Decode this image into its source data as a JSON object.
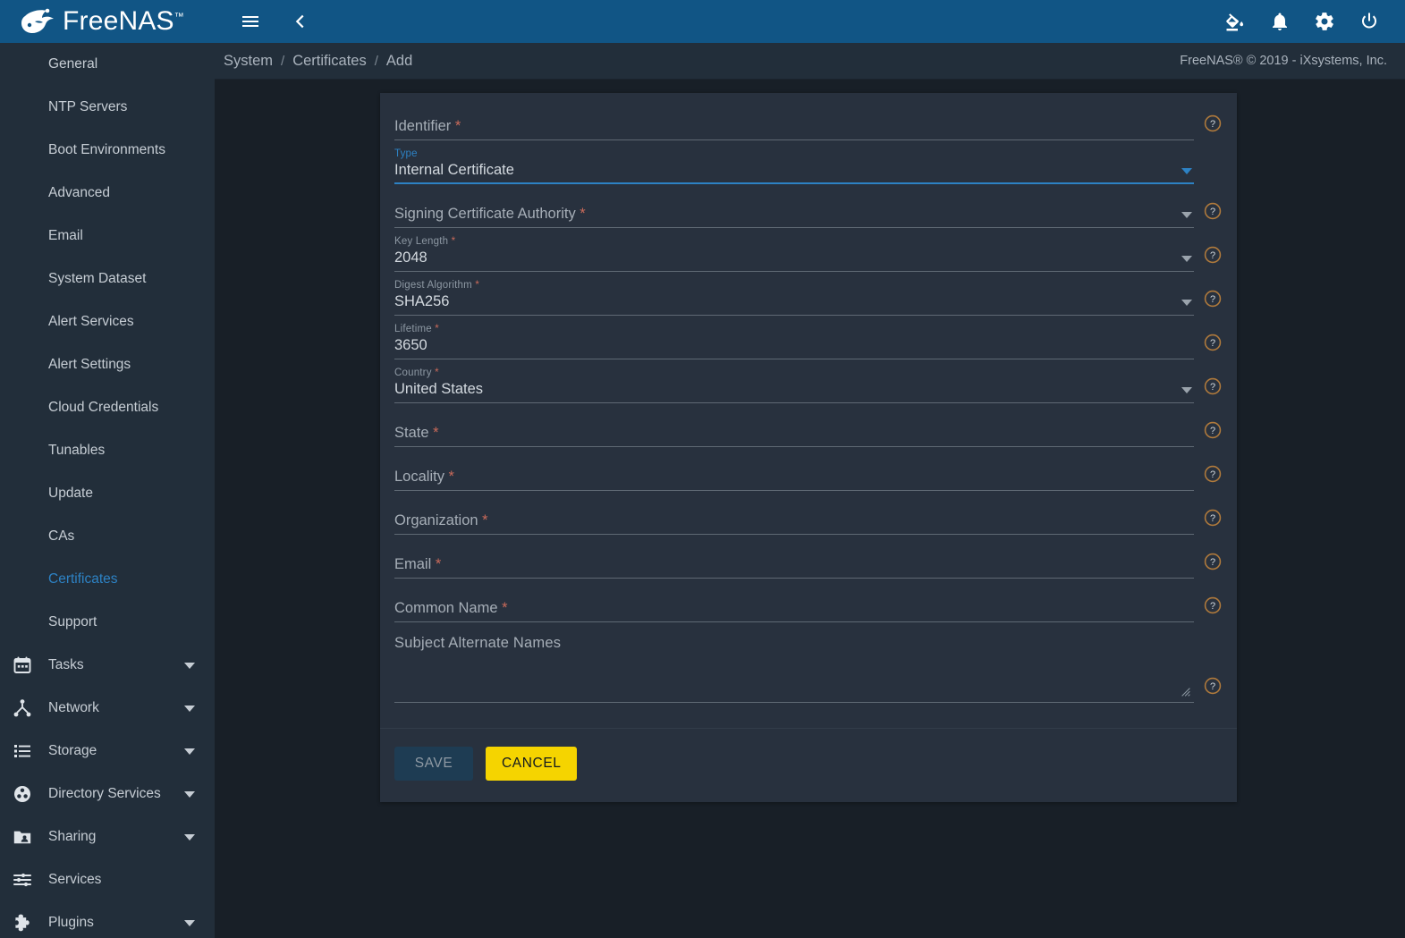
{
  "brand": {
    "name": "FreeNAS",
    "tm": "™",
    "logo_icon": "freenas-shark-logo"
  },
  "topbar": {
    "menu_icon": "hamburger-menu-icon",
    "back_icon": "chevron-left-icon",
    "actions": [
      {
        "name": "theme-picker-icon",
        "label": "Theme"
      },
      {
        "name": "notifications-bell-icon",
        "label": "Notifications"
      },
      {
        "name": "settings-gear-icon",
        "label": "Settings"
      },
      {
        "name": "power-icon",
        "label": "Power"
      }
    ],
    "accent_color": "#115585"
  },
  "sidebar": {
    "sub_items": [
      {
        "label": "General",
        "active": false
      },
      {
        "label": "NTP Servers",
        "active": false
      },
      {
        "label": "Boot Environments",
        "active": false
      },
      {
        "label": "Advanced",
        "active": false
      },
      {
        "label": "Email",
        "active": false
      },
      {
        "label": "System Dataset",
        "active": false
      },
      {
        "label": "Alert Services",
        "active": false
      },
      {
        "label": "Alert Settings",
        "active": false
      },
      {
        "label": "Cloud Credentials",
        "active": false
      },
      {
        "label": "Tunables",
        "active": false
      },
      {
        "label": "Update",
        "active": false
      },
      {
        "label": "CAs",
        "active": false
      },
      {
        "label": "Certificates",
        "active": true
      },
      {
        "label": "Support",
        "active": false
      }
    ],
    "main_items": [
      {
        "label": "Tasks",
        "icon": "calendar-icon",
        "expandable": true
      },
      {
        "label": "Network",
        "icon": "network-node-icon",
        "expandable": true
      },
      {
        "label": "Storage",
        "icon": "storage-list-icon",
        "expandable": true
      },
      {
        "label": "Directory Services",
        "icon": "directory-services-icon",
        "expandable": true
      },
      {
        "label": "Sharing",
        "icon": "folder-share-icon",
        "expandable": true
      },
      {
        "label": "Services",
        "icon": "sliders-icon",
        "expandable": false
      },
      {
        "label": "Plugins",
        "icon": "puzzle-piece-icon",
        "expandable": true
      }
    ],
    "active_color": "#2d82c4"
  },
  "breadcrumb": {
    "items": [
      "System",
      "Certificates",
      "Add"
    ],
    "separator": "/"
  },
  "copyright": "FreeNAS® © 2019 - iXsystems, Inc.",
  "form": {
    "help_icon": "help-circle-icon",
    "dropdown_icon": "chevron-down-icon",
    "resize_icon": "resize-grip-icon",
    "required_marker": "*",
    "fields": [
      {
        "name": "identifier",
        "label": "Identifier",
        "required": true,
        "kind": "text",
        "value": "",
        "placeholder": "",
        "focused": false,
        "has_help": true
      },
      {
        "name": "type",
        "label": "Type",
        "required": false,
        "kind": "select",
        "value": "Internal Certificate",
        "placeholder": "",
        "focused": true,
        "has_help": false
      },
      {
        "name": "signing-certificate-authority",
        "label": "Signing Certificate Authority",
        "required": true,
        "kind": "select",
        "value": "",
        "placeholder": "",
        "focused": false,
        "has_help": true
      },
      {
        "name": "key-length",
        "label": "Key Length",
        "required": true,
        "kind": "select",
        "value": "2048",
        "placeholder": "",
        "focused": false,
        "has_help": true
      },
      {
        "name": "digest-algorithm",
        "label": "Digest Algorithm",
        "required": true,
        "kind": "select",
        "value": "SHA256",
        "placeholder": "",
        "focused": false,
        "has_help": true
      },
      {
        "name": "lifetime",
        "label": "Lifetime",
        "required": true,
        "kind": "text",
        "value": "3650",
        "placeholder": "",
        "focused": false,
        "has_help": true
      },
      {
        "name": "country",
        "label": "Country",
        "required": true,
        "kind": "select",
        "value": "United States",
        "placeholder": "",
        "focused": false,
        "has_help": true
      },
      {
        "name": "state",
        "label": "State",
        "required": true,
        "kind": "text",
        "value": "",
        "placeholder": "",
        "focused": false,
        "has_help": true
      },
      {
        "name": "locality",
        "label": "Locality",
        "required": true,
        "kind": "text",
        "value": "",
        "placeholder": "",
        "focused": false,
        "has_help": true
      },
      {
        "name": "organization",
        "label": "Organization",
        "required": true,
        "kind": "text",
        "value": "",
        "placeholder": "",
        "focused": false,
        "has_help": true
      },
      {
        "name": "email",
        "label": "Email",
        "required": true,
        "kind": "text",
        "value": "",
        "placeholder": "",
        "focused": false,
        "has_help": true
      },
      {
        "name": "common-name",
        "label": "Common Name",
        "required": true,
        "kind": "text",
        "value": "",
        "placeholder": "",
        "focused": false,
        "has_help": true
      },
      {
        "name": "subject-alternate-names",
        "label": "Subject Alternate Names",
        "required": false,
        "kind": "textarea",
        "value": "",
        "placeholder": "",
        "focused": false,
        "has_help": true
      }
    ],
    "buttons": {
      "save": {
        "label": "SAVE",
        "disabled": true,
        "color": "#1e3c53"
      },
      "cancel": {
        "label": "CANCEL",
        "disabled": false,
        "color": "#f5d400"
      }
    }
  }
}
